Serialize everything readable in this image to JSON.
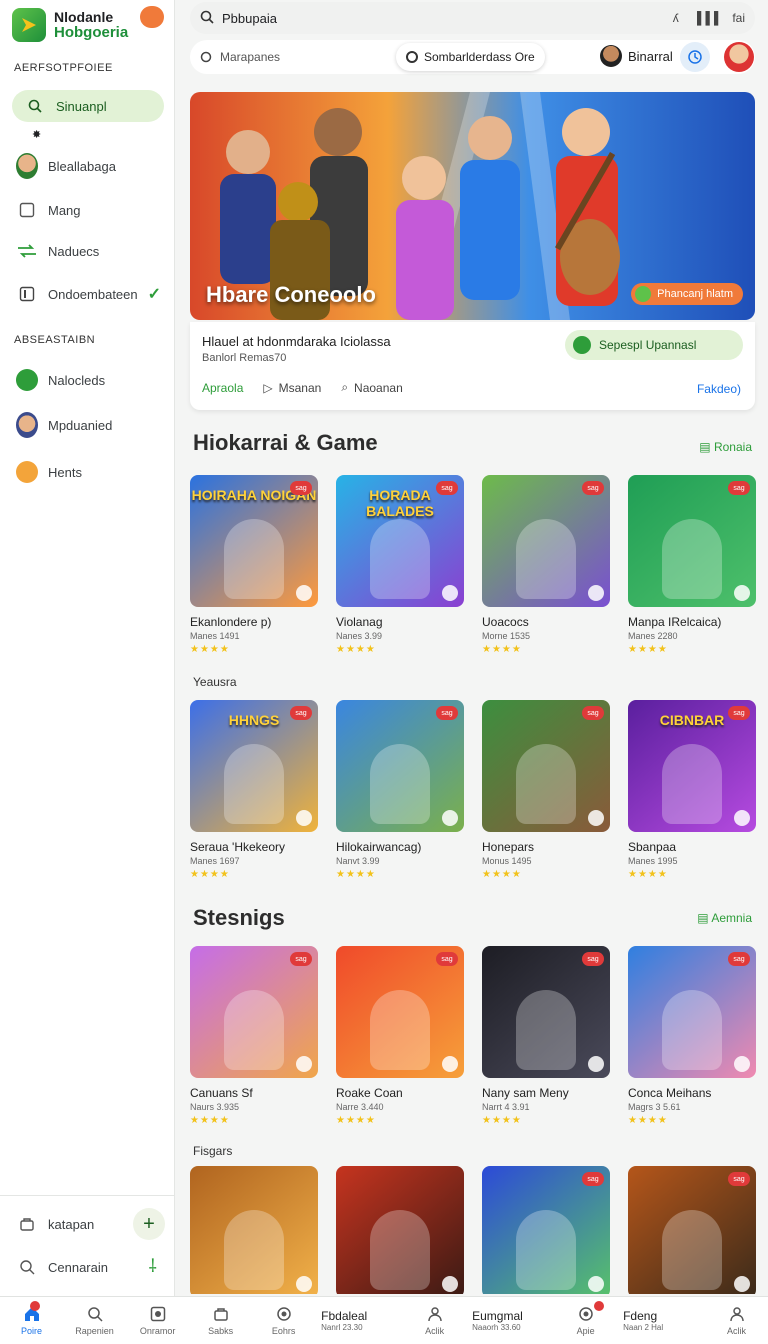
{
  "brand": {
    "line1": "Nlodanle",
    "line2": "Hobgoeria"
  },
  "sidebar": {
    "section1": "AERFSOTPFOIEE",
    "active_item": "Sinuanpl",
    "items": [
      {
        "label": "Bleallabaga",
        "icon": "user-avatar"
      },
      {
        "label": "Mang",
        "icon": "square-icon"
      },
      {
        "label": "Naduecs",
        "icon": "arrows-icon"
      },
      {
        "label": "Ondoembateen",
        "icon": "box-icon"
      }
    ],
    "section2": "ABSEASTAIBN",
    "items2": [
      {
        "label": "Nalocleds",
        "icon": "green-coin"
      },
      {
        "label": "Mpduanied",
        "icon": "user-avatar"
      },
      {
        "label": "Hents",
        "icon": "orange-coin"
      }
    ],
    "footer": [
      {
        "label": "katapan",
        "icon": "bag-icon"
      },
      {
        "label": "Cennarain",
        "icon": "search-icon"
      }
    ]
  },
  "search": {
    "value": "Pbbupaia",
    "right1": "ʎ",
    "right2": "▐▐▐",
    "right3": "fai"
  },
  "subbar": {
    "label": "Marapanes",
    "chip": "Sombarlderdass Ore",
    "user": "Binarral"
  },
  "hero": {
    "title": "Hbare Coneoolo",
    "pill": "Phancanj hlatm",
    "card_title": "Hlauel at hdonmdaraka Iciolassa",
    "card_sub": "Banlorl Remas70",
    "green_btn": "Sepespl Upannasl",
    "actions": [
      "Apraola",
      "Msanan",
      "Naoanan"
    ],
    "right_link": "Fakdeo)"
  },
  "sections": [
    {
      "title": "Hiokarrai & Game",
      "link": "Ronaia",
      "cards": [
        {
          "name": "Ekanlondere p)",
          "meta": "Manes 1491",
          "tag": "sag",
          "thumb_text": "HOIRAHA NOIGAN",
          "c1": "#2a72e0",
          "c2": "#ff9a3c"
        },
        {
          "name": "Violanag",
          "meta": "Nanes 3.99",
          "tag": "sag",
          "thumb_text": "HORADA BALADES",
          "c1": "#27b3e6",
          "c2": "#8b3fd1"
        },
        {
          "name": "Uoacocs",
          "meta": "Morne 1535",
          "tag": "sag",
          "thumb_text": "",
          "c1": "#6dbb4a",
          "c2": "#7a4fd2"
        },
        {
          "name": "Manpa IRelcaica)",
          "meta": "Manes 2280",
          "tag": "sag",
          "thumb_text": "",
          "c1": "#1f9e55",
          "c2": "#4ec06b"
        }
      ],
      "subhead": "Yeausra",
      "cards2": [
        {
          "name": "Seraua 'Hkekeory",
          "meta": "Manes 1697",
          "tag": "sag",
          "thumb_text": "HHNGS",
          "c1": "#3c6fe8",
          "c2": "#f0b33a"
        },
        {
          "name": "Hilokairwancag)",
          "meta": "Nanvt 3.99",
          "tag": "sag",
          "thumb_text": "",
          "c1": "#3a86e0",
          "c2": "#7bb04b"
        },
        {
          "name": "Honepars",
          "meta": "Monus 1495",
          "tag": "sag",
          "thumb_text": "",
          "c1": "#3c8f3f",
          "c2": "#8a5a3a"
        },
        {
          "name": "Sbanpaa",
          "meta": "Manes 1995",
          "tag": "sag",
          "thumb_text": "CIBNBAR",
          "c1": "#5a1f9e",
          "c2": "#b64be0"
        }
      ]
    },
    {
      "title": "Stesnigs",
      "link": "Aemnia",
      "cards": [
        {
          "name": "Canuans Sf",
          "meta": "Naurs 3.935",
          "tag": "sag",
          "thumb_text": "",
          "c1": "#c56de8",
          "c2": "#f0a64a"
        },
        {
          "name": "Roake Coan",
          "meta": "Narre 3.440",
          "tag": "sag",
          "thumb_text": "",
          "c1": "#f04a2a",
          "c2": "#f6a03a"
        },
        {
          "name": "Nany sam Meny",
          "meta": "Narrt 4 3.91",
          "tag": "sag",
          "thumb_text": "",
          "c1": "#1d1d24",
          "c2": "#4a4a5a"
        },
        {
          "name": "Conca Meihans",
          "meta": "Magrs 3 5.61",
          "tag": "sag",
          "thumb_text": "",
          "c1": "#2f7fe0",
          "c2": "#f08ab0"
        }
      ],
      "subhead": "Fisgars",
      "cards2": [
        {
          "name": "",
          "meta": "",
          "tag": "",
          "thumb_text": "",
          "c1": "#b0641f",
          "c2": "#f2b24a"
        },
        {
          "name": "",
          "meta": "",
          "tag": "",
          "thumb_text": "",
          "c1": "#c6341f",
          "c2": "#3a1a14"
        },
        {
          "name": "",
          "meta": "",
          "tag": "sag",
          "thumb_text": "",
          "c1": "#2c4ad8",
          "c2": "#58c26a"
        },
        {
          "name": "",
          "meta": "",
          "tag": "sag",
          "thumb_text": "",
          "c1": "#b5561a",
          "c2": "#3a2a1a"
        }
      ]
    }
  ],
  "bottomnav": {
    "items": [
      {
        "label": "Poire",
        "icon": "home-icon"
      },
      {
        "label": "Rapenien",
        "icon": "search-icon"
      },
      {
        "label": "Onramor",
        "icon": "camera-icon"
      },
      {
        "label": "Sabks",
        "icon": "bag-icon"
      },
      {
        "label": "Eohrs",
        "icon": "target-icon"
      }
    ],
    "text1": {
      "title": "Fbdaleal",
      "sub": "Nanrl 23.30"
    },
    "mid": {
      "label": "Aclik",
      "icon": "person-icon"
    },
    "text2": {
      "title": "Eumgmal",
      "sub": "Naaorh 33.60"
    },
    "apic": {
      "label": "Apie",
      "icon": "target-icon"
    },
    "text3": {
      "title": "Fdeng",
      "sub": "Naan 2 Hal"
    },
    "last": {
      "label": "Aclik",
      "icon": "person-icon"
    }
  },
  "stars": "★★★★"
}
